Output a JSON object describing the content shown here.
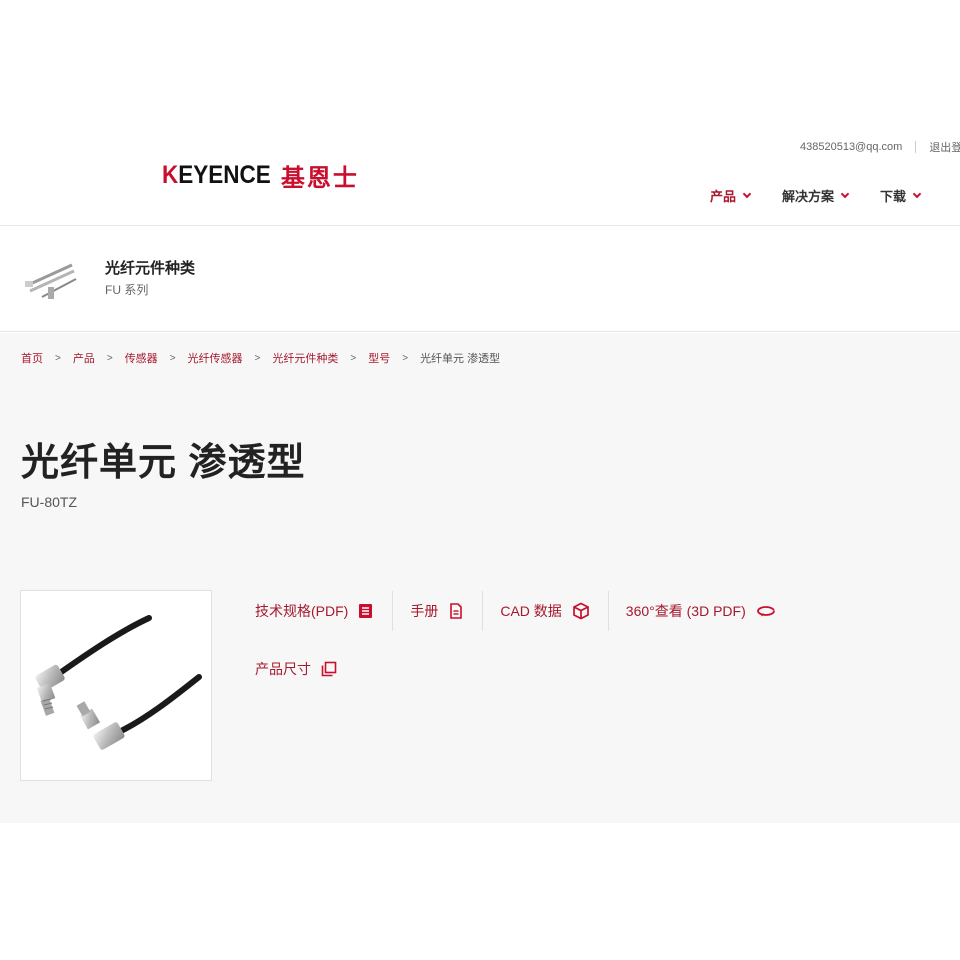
{
  "header": {
    "logo_text": "KEYENCE",
    "logo_cn": "基恩士",
    "user_email": "438520513@qq.com",
    "logout_label": "退出登",
    "nav": [
      {
        "label": "产品",
        "active": true
      },
      {
        "label": "解决方案",
        "active": false
      },
      {
        "label": "下载",
        "active": false
      }
    ]
  },
  "series": {
    "title": "光纤元件种类",
    "subtitle": "FU 系列"
  },
  "breadcrumb": [
    "首页",
    "产品",
    "传感器",
    "光纤传感器",
    "光纤元件种类",
    "型号"
  ],
  "breadcrumb_current": "光纤单元 渗透型",
  "product": {
    "title": "光纤单元 渗透型",
    "model": "FU-80TZ"
  },
  "links": {
    "spec_pdf": "技术规格(PDF)",
    "manual": "手册",
    "cad": "CAD 数据",
    "view360": "360°查看 (3D PDF)",
    "dimensions": "产品尺寸"
  },
  "colors": {
    "brand_red": "#c8102e",
    "link_red": "#a6192e",
    "bg_grey": "#f7f7f7"
  },
  "icons": [
    "document-list-icon",
    "document-icon",
    "cube-icon",
    "rotate-360-icon",
    "copy-icon",
    "chevron-down-icon"
  ]
}
